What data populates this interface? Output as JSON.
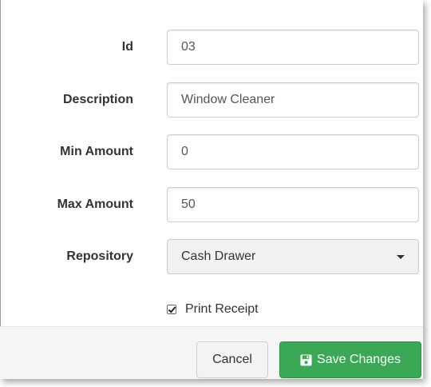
{
  "form": {
    "id": {
      "label": "Id",
      "value": "03"
    },
    "description": {
      "label": "Description",
      "value": "Window Cleaner"
    },
    "min_amount": {
      "label": "Min Amount",
      "value": "0"
    },
    "max_amount": {
      "label": "Max Amount",
      "value": "50"
    },
    "repository": {
      "label": "Repository",
      "selected": "Cash Drawer"
    },
    "print_receipt": {
      "label": "Print Receipt",
      "checked": true
    }
  },
  "footer": {
    "cancel_label": "Cancel",
    "save_label": "Save Changes",
    "save_icon": "floppy-disk-icon"
  },
  "colors": {
    "save_button": "#3aa854",
    "footer_bg": "#f5f5f5"
  }
}
